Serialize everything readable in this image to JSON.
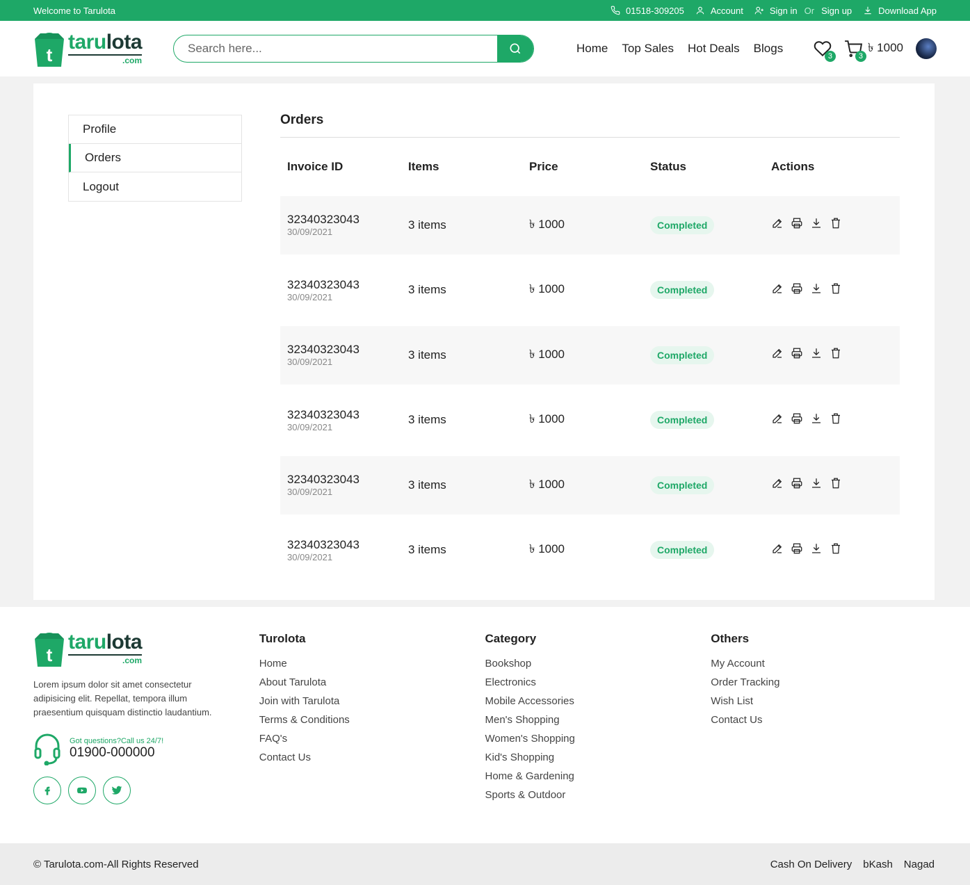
{
  "topbar": {
    "welcome": "Welcome to Tarulota",
    "phone": "01518-309205",
    "account": "Account",
    "sign_in": "Sign in",
    "or": "Or",
    "sign_up": "Sign up",
    "download": "Download App"
  },
  "header": {
    "logo_name_a": "taru",
    "logo_name_b": "lota",
    "logo_domain": ".com",
    "logo_letter": "t",
    "search_placeholder": "Search here...",
    "nav": [
      "Home",
      "Top Sales",
      "Hot Deals",
      "Blogs"
    ],
    "wishlist_count": "3",
    "cart_count": "3",
    "cart_total": "৳ 1000"
  },
  "sidebar": {
    "items": [
      {
        "label": "Profile"
      },
      {
        "label": "Orders"
      },
      {
        "label": "Logout"
      }
    ],
    "active": "Orders"
  },
  "orders": {
    "title": "Orders",
    "columns": [
      "Invoice ID",
      "Items",
      "Price",
      "Status",
      "Actions"
    ],
    "rows": [
      {
        "invoice": "32340323043",
        "date": "30/09/2021",
        "items": "3 items",
        "price": "৳ 1000",
        "status": "Completed"
      },
      {
        "invoice": "32340323043",
        "date": "30/09/2021",
        "items": "3 items",
        "price": "৳ 1000",
        "status": "Completed"
      },
      {
        "invoice": "32340323043",
        "date": "30/09/2021",
        "items": "3 items",
        "price": "৳ 1000",
        "status": "Completed"
      },
      {
        "invoice": "32340323043",
        "date": "30/09/2021",
        "items": "3 items",
        "price": "৳ 1000",
        "status": "Completed"
      },
      {
        "invoice": "32340323043",
        "date": "30/09/2021",
        "items": "3 items",
        "price": "৳ 1000",
        "status": "Completed"
      },
      {
        "invoice": "32340323043",
        "date": "30/09/2021",
        "items": "3 items",
        "price": "৳ 1000",
        "status": "Completed"
      }
    ],
    "action_icons": [
      "edit-icon",
      "print-icon",
      "download-icon",
      "delete-icon"
    ]
  },
  "footer": {
    "description": "Lorem ipsum dolor sit amet consectetur adipisicing elit. Repellat, tempora illum praesentium quisquam distinctio laudantium.",
    "support_label": "Got questions?Call us 24/7!",
    "support_phone": "01900-000000",
    "social": [
      "facebook-icon",
      "youtube-icon",
      "twitter-icon"
    ],
    "columns": [
      {
        "title": "Turolota",
        "links": [
          "Home",
          "About Tarulota",
          "Join with Tarulota",
          "Terms & Conditions",
          "FAQ's",
          "Contact Us"
        ]
      },
      {
        "title": "Category",
        "links": [
          "Bookshop",
          "Electronics",
          "Mobile Accessories",
          "Men's Shopping",
          "Women's Shopping",
          "Kid's Shopping",
          "Home & Gardening",
          "Sports & Outdoor"
        ]
      },
      {
        "title": "Others",
        "links": [
          "My Account",
          "Order Tracking",
          "Wish List",
          "Contact Us"
        ]
      }
    ],
    "copyright": "© Tarulota.com-All Rights Reserved",
    "payments": [
      "Cash On Delivery",
      "bKash",
      "Nagad"
    ]
  },
  "colors": {
    "brand": "#1ea867",
    "dark": "#1d3a34"
  }
}
